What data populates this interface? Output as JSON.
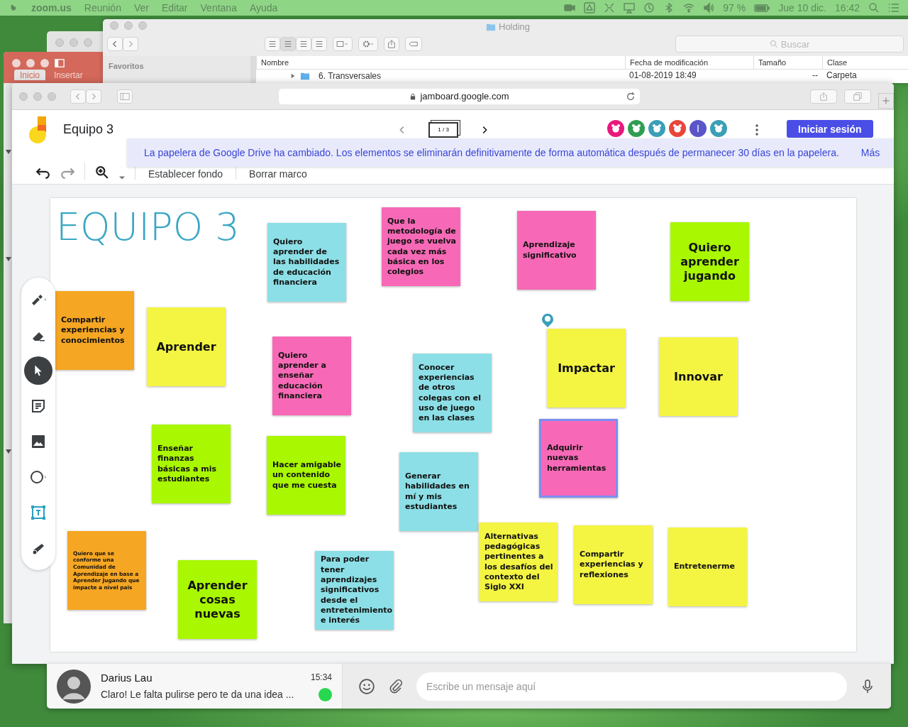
{
  "menu_bar": {
    "app": "zoom.us",
    "menus": [
      "Reunión",
      "Ver",
      "Editar",
      "Ventana",
      "Ayuda"
    ],
    "battery": "97 %",
    "date": "Jue 10 dic.",
    "time": "16:42"
  },
  "word_window": {
    "tabs": [
      {
        "label": "Inicio",
        "selected": true
      },
      {
        "label": "Insertar",
        "selected": false
      }
    ]
  },
  "finder": {
    "title": "Holding",
    "search": {
      "placeholder": "Buscar"
    },
    "view_buttons": [
      {
        "selected": false
      },
      {
        "selected": true
      },
      {
        "selected": false
      },
      {
        "selected": false
      }
    ],
    "sidebar": {
      "heading": "Favoritos"
    },
    "columns": [
      "Nombre",
      "Fecha de modificación",
      "Tamaño",
      "Clase"
    ],
    "rows": [
      {
        "name": "6. Transversales",
        "modified": "01-08-2019 18:49",
        "size": "--",
        "type": "Carpeta"
      }
    ]
  },
  "browser": {
    "url": "jamboard.google.com"
  },
  "jamboard": {
    "title": "Equipo 3",
    "page": "1 / 3",
    "avatars": [
      {
        "kind": "animal",
        "color": "#e8197d"
      },
      {
        "kind": "animal",
        "color": "#2f9e52"
      },
      {
        "kind": "animal",
        "color": "#3a9fb8"
      },
      {
        "kind": "animal",
        "color": "#e8463a"
      },
      {
        "kind": "letter",
        "letter": "I",
        "color": "#5a55c8"
      },
      {
        "kind": "animal",
        "color": "#3aa0b5"
      }
    ],
    "sign_in": "Iniciar sesión",
    "banner": {
      "text": "La papelera de Google Drive ha cambiado. Los elementos se eliminarán definitivamente de forma automática después de permanecer 30 días en la papelera.",
      "link": "Más"
    },
    "toolbar": [
      "Establecer fondo",
      "Borrar marco"
    ],
    "tools": [
      {
        "kind": "pen",
        "selected": false
      },
      {
        "kind": "eraser",
        "selected": false
      },
      {
        "kind": "select",
        "selected": true
      },
      {
        "kind": "note",
        "selected": false
      },
      {
        "kind": "image",
        "selected": false
      },
      {
        "kind": "circle",
        "selected": false
      },
      {
        "kind": "textbox",
        "selected": false
      },
      {
        "kind": "laser",
        "selected": false
      }
    ],
    "board": {
      "heading": "EQUIPO 3",
      "notes": [
        {
          "text": "Compartir experiencias y conocimientos",
          "color": "#f5a623",
          "selected": false
        },
        {
          "text": "Quiero aprender de las habilidades de educación financiera",
          "color": "#8cdfe6",
          "selected": false
        },
        {
          "text": "Que la metodología de juego se vuelva cada vez más básica en los colegios",
          "color": "#f769b6",
          "selected": false
        },
        {
          "text": "Aprendizaje significativo",
          "color": "#f769b6",
          "selected": false
        },
        {
          "text": "Quiero aprender jugando",
          "color": "#a9f700",
          "selected": false
        },
        {
          "text": "Aprender",
          "color": "#f4f542",
          "selected": false
        },
        {
          "text": "Quiero aprender a enseñar educación financiera",
          "color": "#f769b6",
          "selected": false
        },
        {
          "text": "Conocer experiencias de otros colegas con el uso de juego en las clases",
          "color": "#8cdfe6",
          "selected": false
        },
        {
          "text": "Impactar",
          "color": "#f4f542",
          "selected": false
        },
        {
          "text": "Innovar",
          "color": "#f4f542",
          "selected": false
        },
        {
          "text": "Enseñar finanzas básicas a mis estudiantes",
          "color": "#a9f700",
          "selected": false
        },
        {
          "text": "Hacer amigable un contenido que me cuesta",
          "color": "#a9f700",
          "selected": false
        },
        {
          "text": "Generar habilidades en mí y mis estudiantes",
          "color": "#8cdfe6",
          "selected": false
        },
        {
          "text": "Adquirir nuevas herramientas",
          "color": "#f769b6",
          "selected": true
        },
        {
          "text": "Quiero que se conforme una Comunidad de Aprendizaje en base a Aprender Jugando que impacte a nivel pais",
          "color": "#f5a623",
          "selected": false
        },
        {
          "text": "Aprender cosas nuevas",
          "color": "#a9f700",
          "selected": false
        },
        {
          "text": "Para poder tener aprendizajes significativos desde el entretenimiento e interés",
          "color": "#8cdfe6",
          "selected": false
        },
        {
          "text": "Alternativas pedagógicas pertinentes a los desafíos del contexto del Siglo XXI",
          "color": "#f4f542",
          "selected": false
        },
        {
          "text": "Compartir experiencias y reflexiones",
          "color": "#f4f542",
          "selected": false
        },
        {
          "text": "Entretenerme",
          "color": "#f4f542",
          "selected": false
        }
      ]
    }
  },
  "chat": {
    "contact": {
      "name": "Darius Lau",
      "time": "15:34",
      "preview": "Claro! Le falta pulirse pero te da una idea ..."
    },
    "input": {
      "placeholder": "Escribe un mensaje aquí"
    }
  }
}
